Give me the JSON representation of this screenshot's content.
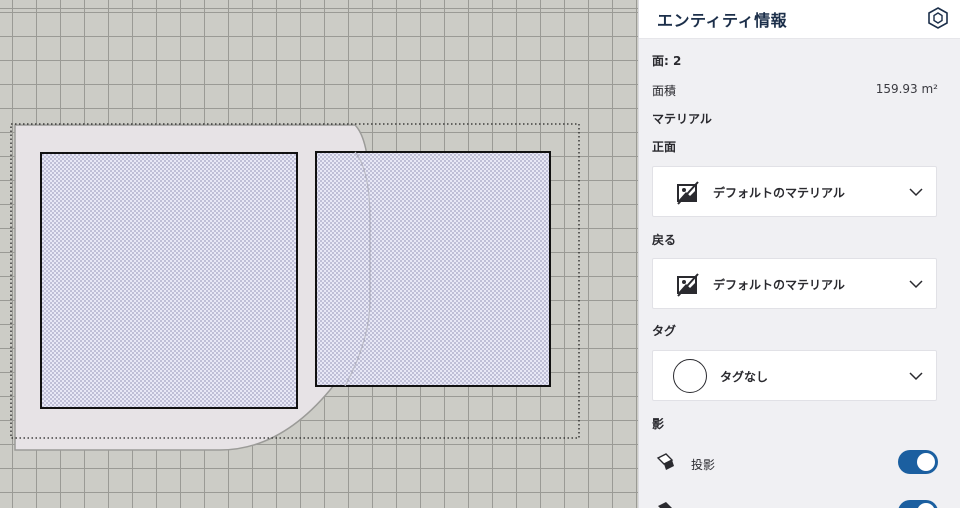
{
  "panel": {
    "title": "エンティティ情報",
    "header_icon": "entity-cube-icon",
    "faces_label": "面: 2",
    "area_label": "面積",
    "area_value": "159.93 m²",
    "material_label": "マテリアル",
    "front_label": "正面",
    "front_material": "デフォルトのマテリアル",
    "back_label": "戻る",
    "back_material": "デフォルトのマテリアル",
    "tag_label": "タグ",
    "tag_value": "タグなし",
    "shadow_label": "影",
    "cast_label": "投影",
    "cast_on": true,
    "receive_on": true
  },
  "viewport": {
    "selection": "2 faces selected",
    "face_fill": "#e6e6f5",
    "shape_fill": "#e7e3e6"
  }
}
